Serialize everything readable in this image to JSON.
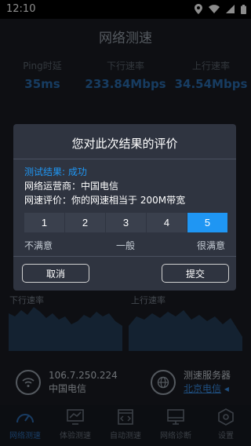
{
  "status": {
    "time": "12:10"
  },
  "header": {
    "title": "网络测速"
  },
  "metrics": [
    {
      "label": "Ping时延",
      "value": "35ms"
    },
    {
      "label": "下行速率",
      "value": "233.84Mbps"
    },
    {
      "label": "上行速率",
      "value": "34.54Mbps"
    }
  ],
  "graphs": {
    "download_label": "下行速率",
    "upload_label": "上行速率"
  },
  "network": {
    "ip": "106.7.250.224",
    "isp": "中国电信"
  },
  "server": {
    "label": "测速服务器",
    "value": "北京电信"
  },
  "nav": [
    {
      "label": "网络测速",
      "icon": "speedometer-icon",
      "active": true
    },
    {
      "label": "体验测速",
      "icon": "chart-monitor-icon"
    },
    {
      "label": "自动测速",
      "icon": "code-window-icon"
    },
    {
      "label": "网络诊断",
      "icon": "monitor-icon"
    },
    {
      "label": "设置",
      "icon": "hexagon-settings-icon"
    }
  ],
  "dialog": {
    "title": "您对此次结果的评价",
    "result_line": "测试结果: 成功",
    "operator_line": "网络运营商：中国电信",
    "eval_line": "网速评价：你的网速相当于 200M带宽",
    "ratings": [
      "1",
      "2",
      "3",
      "4",
      "5"
    ],
    "selected_rating": "5",
    "low_label": "不满意",
    "mid_label": "一般",
    "high_label": "很满意",
    "cancel": "取消",
    "submit": "提交"
  },
  "colors": {
    "accent": "#1f96f3",
    "active_nav": "#2e6db4",
    "metric_value": "#2a6db1"
  }
}
